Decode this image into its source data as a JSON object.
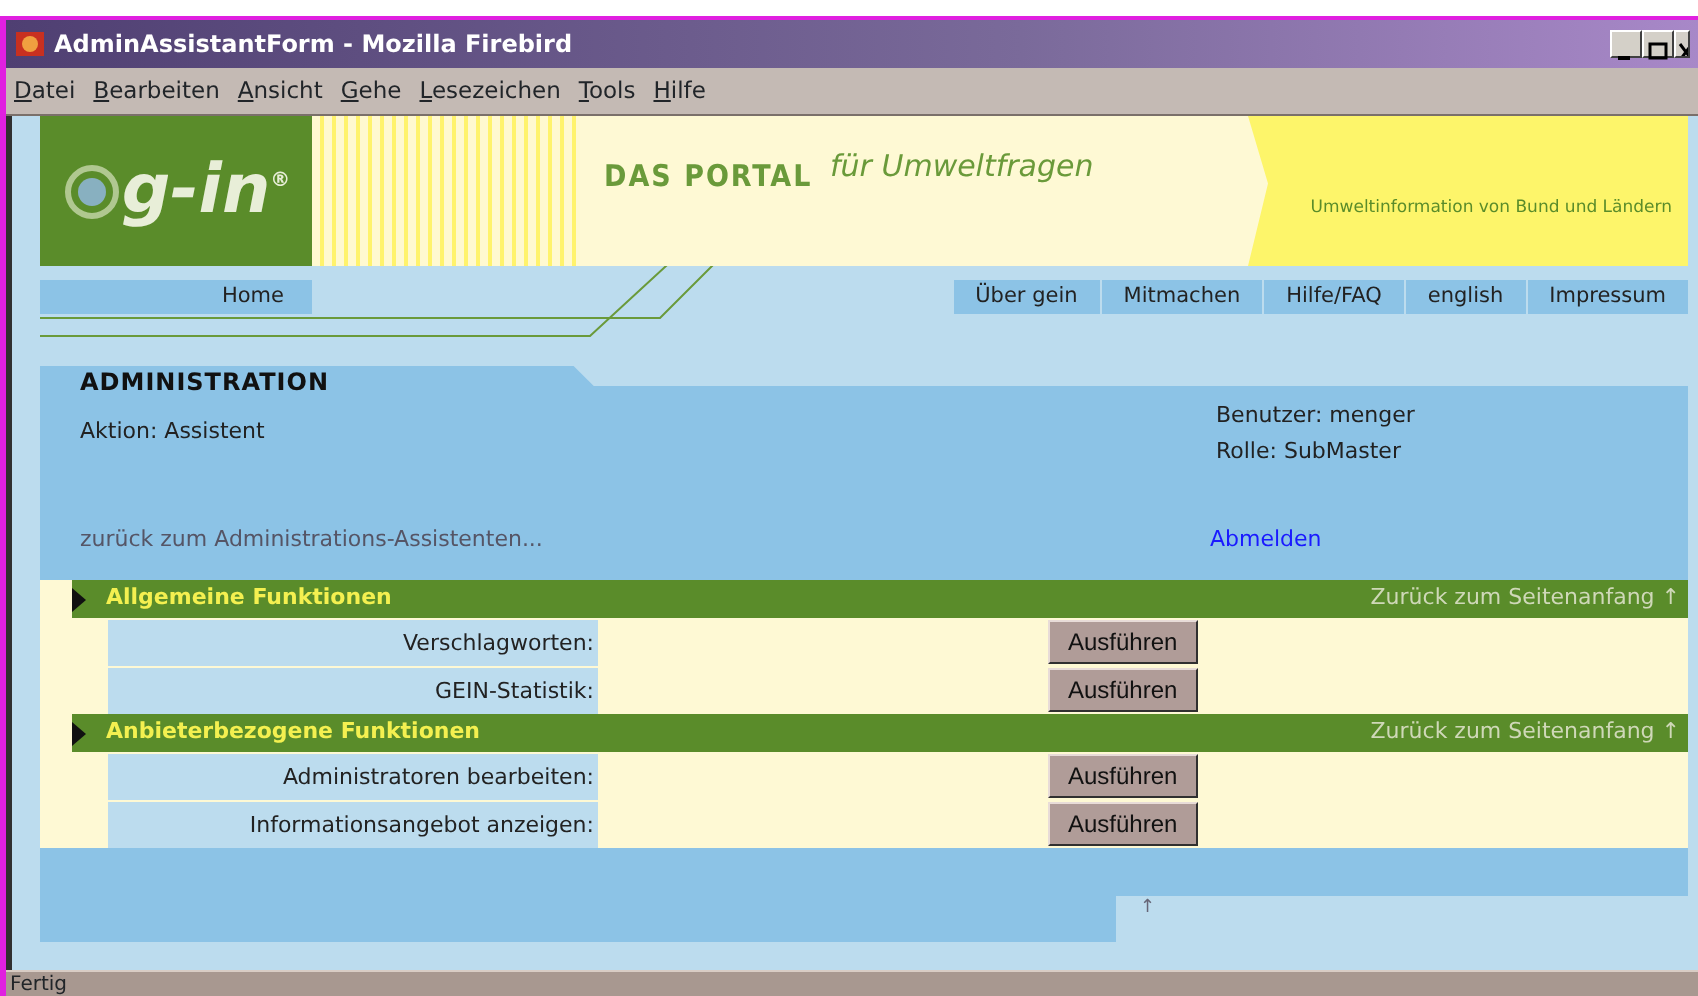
{
  "window": {
    "title": "AdminAssistantForm - Mozilla Firebird"
  },
  "menu": [
    "Datei",
    "Bearbeiten",
    "Ansicht",
    "Gehe",
    "Lesezeichen",
    "Tools",
    "Hilfe"
  ],
  "header": {
    "logo": "g-in",
    "logo_mark": "®",
    "title": "DAS PORTAL",
    "subtitle": "für Umweltfragen",
    "tagline": "Umweltinformation von Bund und Ländern"
  },
  "nav": {
    "left": [
      "Home"
    ],
    "right": [
      "Über gein",
      "Mitmachen",
      "Hilfe/FAQ",
      "english",
      "Impressum"
    ]
  },
  "admin": {
    "heading": "ADMINISTRATION",
    "action": "Aktion: Assistent",
    "user": "Benutzer: menger",
    "role": "Rolle: SubMaster",
    "back_link": "zurück zum Administrations-Assistenten...",
    "logout_link": "Abmelden"
  },
  "sections": [
    {
      "title": "Allgemeine Funktionen",
      "top_link": "Zurück zum Seitenanfang",
      "top_arrow": "↑",
      "rows": [
        {
          "label": "Verschlagworten:",
          "button": "Ausführen"
        },
        {
          "label": "GEIN-Statistik:",
          "button": "Ausführen"
        }
      ]
    },
    {
      "title": "Anbieterbezogene Funktionen",
      "top_link": "Zurück zum Seitenanfang",
      "top_arrow": "↑",
      "rows": [
        {
          "label": "Administratoren bearbeiten:",
          "button": "Ausführen"
        },
        {
          "label": "Informationsangebot anzeigen:",
          "button": "Ausführen"
        }
      ]
    }
  ],
  "footer_arrow": "↑",
  "status_bar": "Fertig"
}
